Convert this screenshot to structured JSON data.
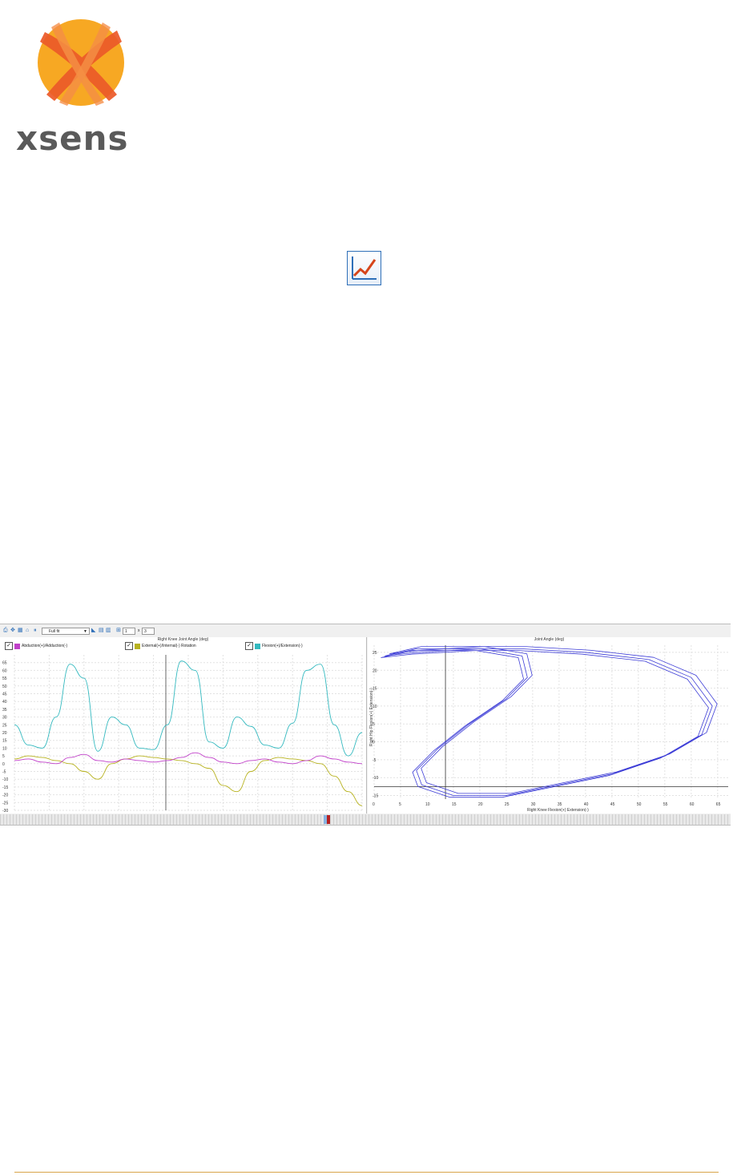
{
  "logo": {
    "brand_text": "xsens",
    "colors": [
      "#f7a823",
      "#ec5a29",
      "#f48d46"
    ]
  },
  "toolbar": {
    "zoom_value": "Full fit",
    "rows_value": "1",
    "cols_value": "3",
    "times_symbol": "x",
    "icons": [
      "printer-icon",
      "pan-icon",
      "chart-grid-icon",
      "home-icon",
      "pause-icon"
    ]
  },
  "left_chart": {
    "title": "Right Knee Joint Angle (deg)",
    "legend": [
      {
        "label": "Abduction(+)/Adduction(-)",
        "color": "#c03fc9"
      },
      {
        "label": "External(+)/Internal(-) Rotation",
        "color": "#b7b21e"
      },
      {
        "label": "Flexion(+)/Extension(-)",
        "color": "#33b9bf"
      }
    ],
    "y_ticks": [
      "65",
      "60",
      "55",
      "50",
      "45",
      "40",
      "35",
      "30",
      "25",
      "20",
      "15",
      "10",
      "5",
      "0",
      "-5",
      "-10",
      "-15",
      "-20",
      "-25",
      "-30"
    ]
  },
  "right_chart": {
    "title": "Joint Angle (deg)",
    "xlabel": "Right Knee Flexion(+) Extension(-)",
    "ylabel": "Right Hip Flexion(+) Extension(-)",
    "x_ticks": [
      "0",
      "5",
      "10",
      "15",
      "20",
      "25",
      "30",
      "35",
      "40",
      "45",
      "50",
      "55",
      "60",
      "65"
    ],
    "y_ticks": [
      "25",
      "20",
      "15",
      "10",
      "5",
      "0",
      "-5",
      "-10",
      "-15"
    ]
  },
  "chart_data": [
    {
      "type": "line",
      "title": "Right Knee Joint Angle (deg)",
      "ylim": [
        -30,
        70
      ],
      "x": [
        0,
        4,
        8,
        12,
        16,
        20,
        24,
        28,
        32,
        36,
        40,
        44,
        48,
        52,
        56,
        60,
        64,
        68,
        72,
        76,
        80,
        84,
        88,
        92,
        96,
        100
      ],
      "series": [
        {
          "name": "Flexion(+)/Extension(-)",
          "values": [
            25,
            12,
            10,
            30,
            64,
            55,
            8,
            30,
            25,
            10,
            9,
            25,
            66,
            60,
            14,
            10,
            30,
            24,
            12,
            10,
            26,
            60,
            64,
            25,
            5,
            20
          ]
        },
        {
          "name": "External(+)/Internal(-) Rotation",
          "values": [
            3,
            5,
            4,
            2,
            0,
            -5,
            -10,
            0,
            3,
            5,
            4,
            3,
            2,
            0,
            -3,
            -14,
            -18,
            -5,
            2,
            4,
            3,
            2,
            0,
            -8,
            -18,
            -27
          ]
        },
        {
          "name": "Abduction(+)/Adduction(-)",
          "values": [
            2,
            3,
            1,
            0,
            4,
            6,
            2,
            1,
            3,
            2,
            1,
            2,
            4,
            7,
            4,
            1,
            0,
            2,
            3,
            1,
            0,
            2,
            5,
            3,
            1,
            0
          ]
        }
      ]
    },
    {
      "type": "scatter",
      "title": "Joint Angle (deg)",
      "xlabel": "Right Knee Flexion(+) Extension(-)",
      "ylabel": "Right Hip Flexion(+) Extension(-)",
      "xlim": [
        0,
        67
      ],
      "ylim": [
        -16,
        27
      ],
      "x": [
        2,
        8,
        16,
        28,
        40,
        52,
        60,
        64,
        62,
        55,
        45,
        35,
        25,
        15,
        9,
        8,
        12,
        18,
        25,
        29,
        28,
        20,
        8,
        2
      ],
      "y": [
        24,
        26,
        26,
        26,
        25,
        23,
        18,
        10,
        2,
        -4,
        -9,
        -12,
        -15,
        -15,
        -12,
        -8,
        -2,
        5,
        12,
        18,
        24,
        26,
        25,
        24
      ]
    }
  ]
}
